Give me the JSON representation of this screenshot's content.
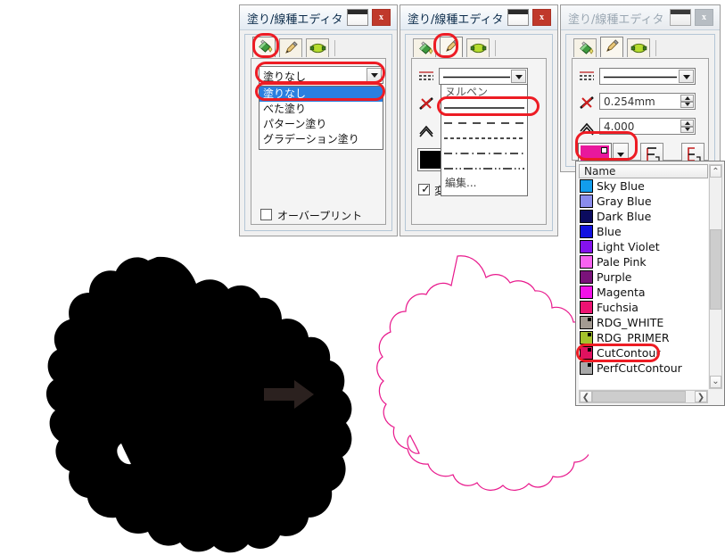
{
  "dialogs": {
    "fill": {
      "title": "塗り/線種エディタ",
      "restore_label": "",
      "close_label": "x",
      "tabs": [
        {
          "name": "fill-tab",
          "icon": "paint-bucket-icon",
          "selected": true
        },
        {
          "name": "stroke-paint-tab",
          "icon": "pencil-icon",
          "selected": false
        },
        {
          "name": "stroke-style-tab",
          "icon": "stroke-shape-icon",
          "selected": false
        }
      ],
      "combo_value": "塗りなし",
      "options": [
        "塗りなし",
        "べた塗り",
        "パターン塗り",
        "グラデーション塗り"
      ],
      "selected_option": "塗りなし",
      "overprint_label": "オーバープリント",
      "overprint_checked": false
    },
    "stroke": {
      "title": "塗り/線種エディタ",
      "restore_label": "",
      "close_label": "x",
      "tabs": [
        {
          "name": "fill-tab",
          "icon": "paint-bucket-icon",
          "selected": false
        },
        {
          "name": "stroke-paint-tab",
          "icon": "pencil-icon",
          "selected": true
        },
        {
          "name": "stroke-style-tab",
          "icon": "stroke-shape-icon",
          "selected": false
        }
      ],
      "combo_value": "",
      "dash_options": [
        {
          "label": "ヌルペン",
          "pattern": "none"
        },
        {
          "label": "",
          "pattern": "solid",
          "highlighted": true
        },
        {
          "label": "",
          "pattern": "dash-long"
        },
        {
          "label": "",
          "pattern": "dash-short"
        },
        {
          "label": "",
          "pattern": "dash-dot"
        },
        {
          "label": "",
          "pattern": "dash-dot-dot"
        },
        {
          "label": "編集...",
          "pattern": "none"
        }
      ],
      "swatch_color": "#000000",
      "bottom_checkbox_checked": true,
      "bottom_checkbox_label": "変"
    },
    "color": {
      "title": "塗り/線種エディタ",
      "restore_label": "",
      "close_label": "x",
      "active": false,
      "tabs": [
        {
          "name": "fill-tab",
          "icon": "paint-bucket-icon",
          "selected": false
        },
        {
          "name": "stroke-paint-tab",
          "icon": "pencil-icon",
          "selected": true
        },
        {
          "name": "stroke-style-tab",
          "icon": "stroke-shape-icon",
          "selected": false
        }
      ],
      "dash_combo_value": "",
      "width_value": "0.254mm",
      "miter_value": "4.000",
      "swatch_color": "#e8189c",
      "join_button_label": "",
      "cap_button_label": ""
    }
  },
  "color_list": {
    "header": "Name",
    "items": [
      {
        "name": "Sky Blue",
        "color": "#129ded",
        "spot": false
      },
      {
        "name": "Gray Blue",
        "color": "#8a8cec",
        "spot": false
      },
      {
        "name": "Dark Blue",
        "color": "#0b0b5e",
        "spot": false
      },
      {
        "name": "Blue",
        "color": "#1212e0",
        "spot": false
      },
      {
        "name": "Light Violet",
        "color": "#8412ed",
        "spot": false
      },
      {
        "name": "Pale Pink",
        "color": "#f763f0",
        "spot": false
      },
      {
        "name": "Purple",
        "color": "#7a137a",
        "spot": false
      },
      {
        "name": "Magenta",
        "color": "#f312e8",
        "spot": false
      },
      {
        "name": "Fuchsia",
        "color": "#ed1372",
        "spot": false
      },
      {
        "name": "RDG_WHITE",
        "color": "#a39a92",
        "spot": true
      },
      {
        "name": "RDG_PRIMER",
        "color": "#a4c22c",
        "spot": true
      },
      {
        "name": "CutContour",
        "color": "#e0125f",
        "spot": true,
        "highlighted": true
      },
      {
        "name": "PerfCutContour",
        "color": "#a8a8a8",
        "spot": true
      }
    ],
    "scroll_up_label": "⌃",
    "scroll_down_label": "⌄",
    "scroll_left_label": "❮",
    "scroll_right_label": "❯"
  },
  "canvas": {
    "before_shape_name": "filled-black-blob",
    "before_shape_color": "#000000",
    "arrow_color": "#2b211f",
    "after_shape_name": "magenta-cutcontour-outline",
    "after_shape_color": "#e8188c"
  },
  "accents": {
    "highlight_ring": "#ed1c24",
    "selection_blue": "#2a7fe0"
  }
}
